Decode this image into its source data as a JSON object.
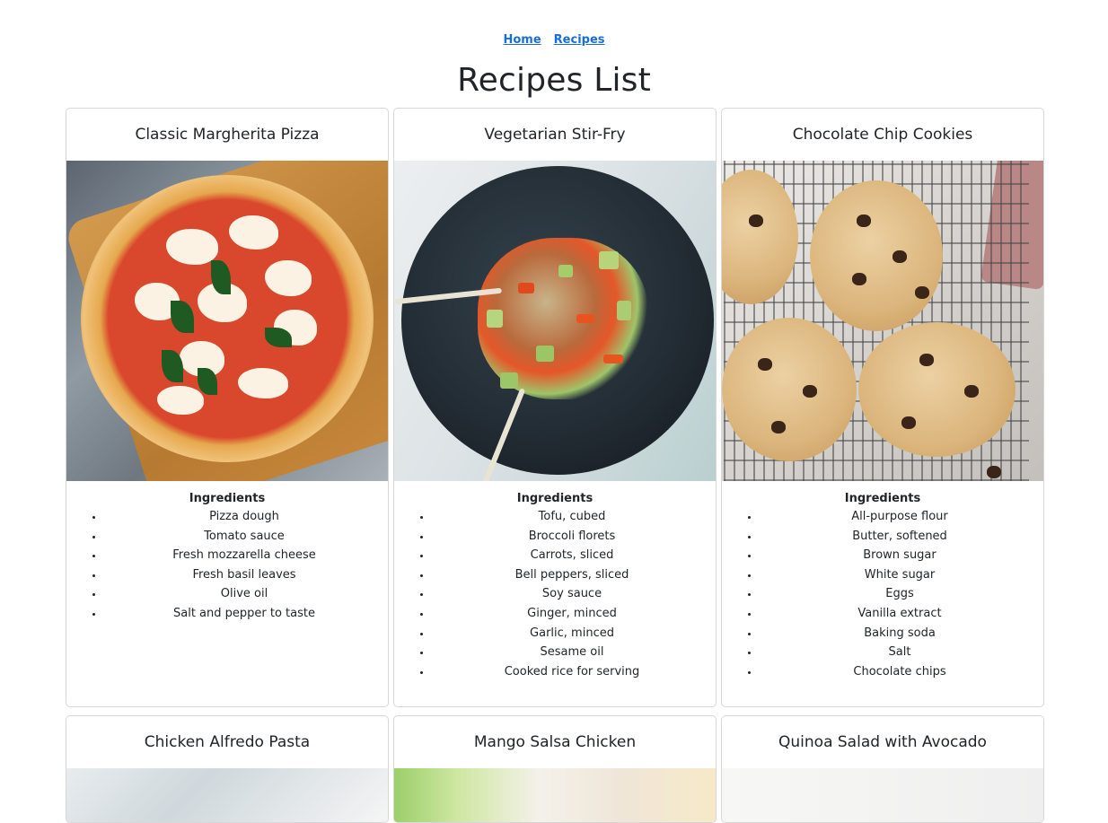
{
  "nav": {
    "home": "Home",
    "recipes": "Recipes"
  },
  "page_title": "Recipes List",
  "recipes": [
    {
      "title": "Classic Margherita Pizza",
      "ingredients_heading": "Ingredients",
      "ingredients": [
        "Pizza dough",
        "Tomato sauce",
        "Fresh mozzarella cheese",
        "Fresh basil leaves",
        "Olive oil",
        "Salt and pepper to taste"
      ]
    },
    {
      "title": "Vegetarian Stir-Fry",
      "ingredients_heading": "Ingredients",
      "ingredients": [
        "Tofu, cubed",
        "Broccoli florets",
        "Carrots, sliced",
        "Bell peppers, sliced",
        "Soy sauce",
        "Ginger, minced",
        "Garlic, minced",
        "Sesame oil",
        "Cooked rice for serving"
      ]
    },
    {
      "title": "Chocolate Chip Cookies",
      "ingredients_heading": "Ingredients",
      "ingredients": [
        "All-purpose flour",
        "Butter, softened",
        "Brown sugar",
        "White sugar",
        "Eggs",
        "Vanilla extract",
        "Baking soda",
        "Salt",
        "Chocolate chips"
      ]
    },
    {
      "title": "Chicken Alfredo Pasta"
    },
    {
      "title": "Mango Salsa Chicken"
    },
    {
      "title": "Quinoa Salad with Avocado"
    }
  ]
}
